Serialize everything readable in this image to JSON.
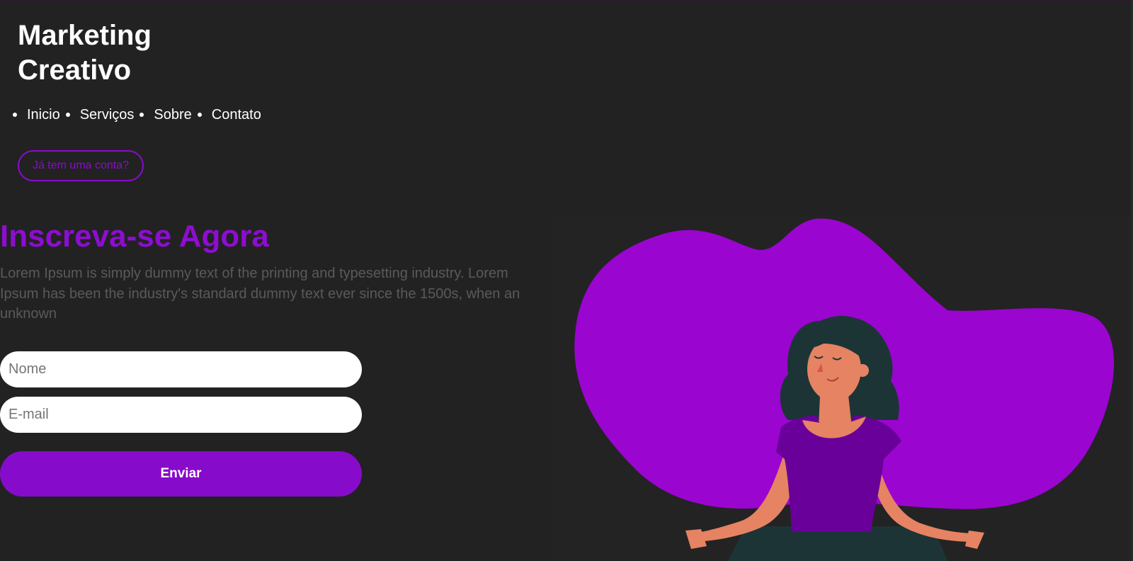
{
  "brand": {
    "title_line1": "Marketing",
    "title_line2": "Creativo"
  },
  "nav": {
    "items": [
      {
        "label": "Inicio"
      },
      {
        "label": "Serviços"
      },
      {
        "label": "Sobre"
      },
      {
        "label": "Contato"
      }
    ]
  },
  "header": {
    "account_button_label": "Já tem uma conta?"
  },
  "hero": {
    "title": "Inscreva-se Agora",
    "description": "Lorem Ipsum is simply dummy text of the printing and typesetting industry. Lorem Ipsum has been the industry's standard dummy text ever since the 1500s, when an unknown"
  },
  "form": {
    "name_placeholder": "Nome",
    "email_placeholder": "E-mail",
    "submit_label": "Enviar"
  },
  "colors": {
    "background": "#222222",
    "accent": "#870bcb",
    "blob": "#9b05d0",
    "muted_text": "#5a5a5a"
  },
  "illustration": {
    "icon": "meditating-woman-illustration"
  }
}
